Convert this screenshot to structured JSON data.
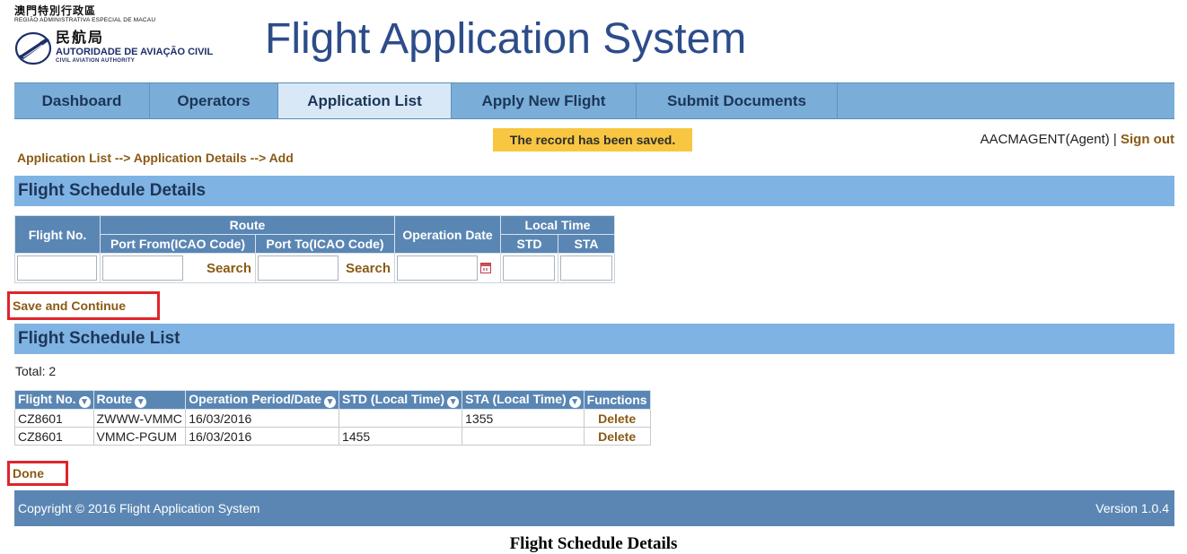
{
  "logo": {
    "line1": "澳門特別行政區",
    "line2": "REGIÃO ADMINISTRATIVA ESPECIAL DE MACAU",
    "line3": "民航局",
    "line4": "AUTORIDADE DE AVIAÇÃO CIVIL",
    "line5": "CIVIL AVIATION AUTHORITY",
    "icon": "airplane-emblem-icon"
  },
  "app_title": "Flight Application System",
  "nav": {
    "tabs": [
      {
        "label": "Dashboard",
        "active": false
      },
      {
        "label": "Operators",
        "active": false
      },
      {
        "label": "Application List",
        "active": true
      },
      {
        "label": "Apply New Flight",
        "active": false
      },
      {
        "label": "Submit Documents",
        "active": false
      }
    ]
  },
  "status_message": "The record has been saved.",
  "user": {
    "name": "AACMAGENT(Agent)",
    "separator": " | ",
    "sign_out": "Sign out"
  },
  "breadcrumb": {
    "items": [
      "Application List",
      "Application Details",
      "Add"
    ],
    "separator": " --> "
  },
  "schedule_details": {
    "title": "Flight Schedule Details",
    "headers": {
      "flight_no": "Flight No.",
      "route": "Route",
      "port_from": "Port From(ICAO Code)",
      "port_to": "Port To(ICAO Code)",
      "operation_date": "Operation Date",
      "local_time": "Local Time",
      "std": "STD",
      "sta": "STA"
    },
    "fields": {
      "flight_no": "",
      "port_from": "",
      "port_to": "",
      "operation_date": "",
      "std": "",
      "sta": ""
    },
    "search_label": "Search",
    "save_continue": "Save and Continue"
  },
  "schedule_list": {
    "title": "Flight Schedule List",
    "total": "Total: 2",
    "columns": [
      {
        "label": "Flight No.",
        "sortable": true
      },
      {
        "label": "Route",
        "sortable": true
      },
      {
        "label": "Operation Period/Date",
        "sortable": true
      },
      {
        "label": "STD (Local Time)",
        "sortable": true
      },
      {
        "label": "STA (Local Time)",
        "sortable": true
      },
      {
        "label": "Functions",
        "sortable": false
      }
    ],
    "rows": [
      {
        "flight_no": "CZ8601",
        "route": "ZWWW-VMMC",
        "date": "16/03/2016",
        "std": "",
        "sta": "1355",
        "action": "Delete"
      },
      {
        "flight_no": "CZ8601",
        "route": "VMMC-PGUM",
        "date": "16/03/2016",
        "std": "1455",
        "sta": "",
        "action": "Delete"
      }
    ],
    "sort_icon": "sort-circle-icon",
    "done": "Done"
  },
  "footer": {
    "copyright": "Copyright © 2016 Flight Application System",
    "version": "Version 1.0.4"
  },
  "caption": "Flight Schedule Details",
  "colors": {
    "nav_bg": "#7aaed8",
    "section_bg": "#7fb3e3",
    "table_header": "#5a86b4",
    "link": "#8a5a14",
    "badge": "#f8c640",
    "highlight_border": "#e0242c",
    "footer_bg": "#5b86b3"
  }
}
